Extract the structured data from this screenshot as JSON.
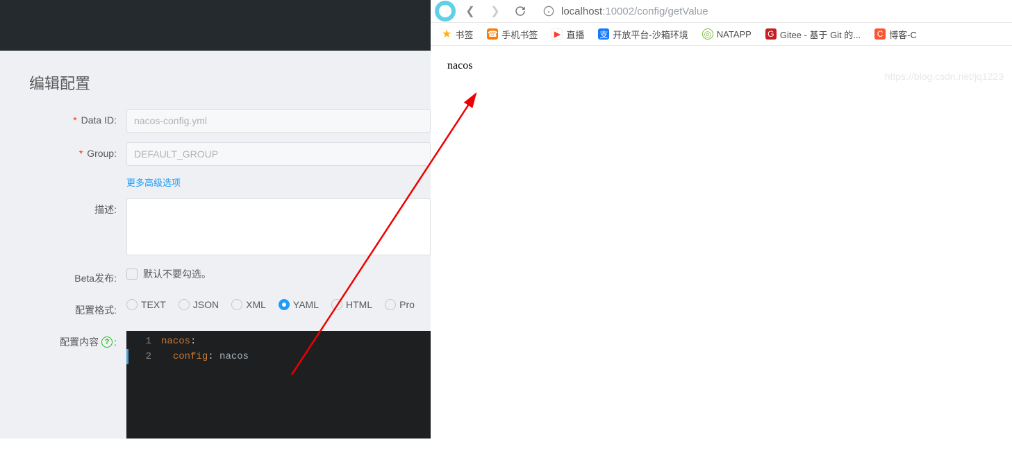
{
  "left": {
    "title": "编辑配置",
    "labels": {
      "dataId": "Data ID:",
      "group": "Group:",
      "desc": "描述:",
      "beta": "Beta发布:",
      "format": "配置格式:",
      "content": "配置内容"
    },
    "dataId": "nacos-config.yml",
    "group": "DEFAULT_GROUP",
    "link": "更多高级选项",
    "betaHint": "默认不要勾选。",
    "formats": [
      "TEXT",
      "JSON",
      "XML",
      "YAML",
      "HTML",
      "Pro"
    ],
    "formatSelected": "YAML",
    "editor": {
      "lines": [
        {
          "num": "1",
          "k": "nacos",
          "v": ""
        },
        {
          "num": "2",
          "indent": "  ",
          "k": "config",
          "v": "nacos"
        }
      ]
    }
  },
  "right": {
    "url_host": "localhost",
    "url_port": ":10002",
    "url_path": "/config/getValue",
    "bookmarks": [
      {
        "icon": "star",
        "label": "书签",
        "bg": "#ffb100"
      },
      {
        "icon": "phone",
        "label": "手机书签",
        "bg": "#ff7a00"
      },
      {
        "icon": "tv",
        "label": "直播",
        "bg": "#ff7a00"
      },
      {
        "icon": "支",
        "label": "开放平台-沙箱环境",
        "bg": "#1677ff"
      },
      {
        "icon": "N",
        "label": "NATAPP",
        "bg": "#7fb93a"
      },
      {
        "icon": "G",
        "label": "Gitee - 基于 Git 的...",
        "bg": "#c71d23"
      },
      {
        "icon": "C",
        "label": "博客-C",
        "bg": "#fc5531"
      }
    ],
    "page_text": "nacos",
    "watermark": "https://blog.csdn.net/jq1223"
  }
}
